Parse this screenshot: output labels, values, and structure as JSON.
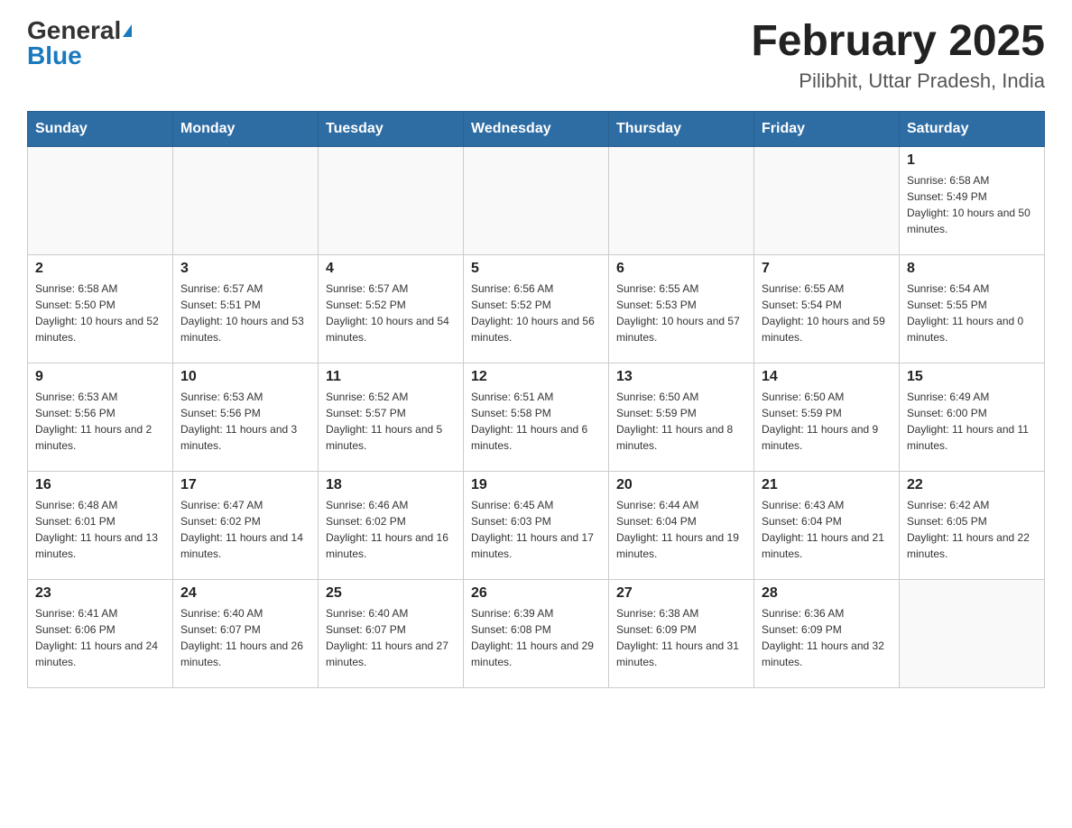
{
  "header": {
    "logo_general": "General",
    "logo_blue": "Blue",
    "title": "February 2025",
    "subtitle": "Pilibhit, Uttar Pradesh, India"
  },
  "weekdays": [
    "Sunday",
    "Monday",
    "Tuesday",
    "Wednesday",
    "Thursday",
    "Friday",
    "Saturday"
  ],
  "weeks": [
    [
      {
        "day": "",
        "info": ""
      },
      {
        "day": "",
        "info": ""
      },
      {
        "day": "",
        "info": ""
      },
      {
        "day": "",
        "info": ""
      },
      {
        "day": "",
        "info": ""
      },
      {
        "day": "",
        "info": ""
      },
      {
        "day": "1",
        "info": "Sunrise: 6:58 AM\nSunset: 5:49 PM\nDaylight: 10 hours and 50 minutes."
      }
    ],
    [
      {
        "day": "2",
        "info": "Sunrise: 6:58 AM\nSunset: 5:50 PM\nDaylight: 10 hours and 52 minutes."
      },
      {
        "day": "3",
        "info": "Sunrise: 6:57 AM\nSunset: 5:51 PM\nDaylight: 10 hours and 53 minutes."
      },
      {
        "day": "4",
        "info": "Sunrise: 6:57 AM\nSunset: 5:52 PM\nDaylight: 10 hours and 54 minutes."
      },
      {
        "day": "5",
        "info": "Sunrise: 6:56 AM\nSunset: 5:52 PM\nDaylight: 10 hours and 56 minutes."
      },
      {
        "day": "6",
        "info": "Sunrise: 6:55 AM\nSunset: 5:53 PM\nDaylight: 10 hours and 57 minutes."
      },
      {
        "day": "7",
        "info": "Sunrise: 6:55 AM\nSunset: 5:54 PM\nDaylight: 10 hours and 59 minutes."
      },
      {
        "day": "8",
        "info": "Sunrise: 6:54 AM\nSunset: 5:55 PM\nDaylight: 11 hours and 0 minutes."
      }
    ],
    [
      {
        "day": "9",
        "info": "Sunrise: 6:53 AM\nSunset: 5:56 PM\nDaylight: 11 hours and 2 minutes."
      },
      {
        "day": "10",
        "info": "Sunrise: 6:53 AM\nSunset: 5:56 PM\nDaylight: 11 hours and 3 minutes."
      },
      {
        "day": "11",
        "info": "Sunrise: 6:52 AM\nSunset: 5:57 PM\nDaylight: 11 hours and 5 minutes."
      },
      {
        "day": "12",
        "info": "Sunrise: 6:51 AM\nSunset: 5:58 PM\nDaylight: 11 hours and 6 minutes."
      },
      {
        "day": "13",
        "info": "Sunrise: 6:50 AM\nSunset: 5:59 PM\nDaylight: 11 hours and 8 minutes."
      },
      {
        "day": "14",
        "info": "Sunrise: 6:50 AM\nSunset: 5:59 PM\nDaylight: 11 hours and 9 minutes."
      },
      {
        "day": "15",
        "info": "Sunrise: 6:49 AM\nSunset: 6:00 PM\nDaylight: 11 hours and 11 minutes."
      }
    ],
    [
      {
        "day": "16",
        "info": "Sunrise: 6:48 AM\nSunset: 6:01 PM\nDaylight: 11 hours and 13 minutes."
      },
      {
        "day": "17",
        "info": "Sunrise: 6:47 AM\nSunset: 6:02 PM\nDaylight: 11 hours and 14 minutes."
      },
      {
        "day": "18",
        "info": "Sunrise: 6:46 AM\nSunset: 6:02 PM\nDaylight: 11 hours and 16 minutes."
      },
      {
        "day": "19",
        "info": "Sunrise: 6:45 AM\nSunset: 6:03 PM\nDaylight: 11 hours and 17 minutes."
      },
      {
        "day": "20",
        "info": "Sunrise: 6:44 AM\nSunset: 6:04 PM\nDaylight: 11 hours and 19 minutes."
      },
      {
        "day": "21",
        "info": "Sunrise: 6:43 AM\nSunset: 6:04 PM\nDaylight: 11 hours and 21 minutes."
      },
      {
        "day": "22",
        "info": "Sunrise: 6:42 AM\nSunset: 6:05 PM\nDaylight: 11 hours and 22 minutes."
      }
    ],
    [
      {
        "day": "23",
        "info": "Sunrise: 6:41 AM\nSunset: 6:06 PM\nDaylight: 11 hours and 24 minutes."
      },
      {
        "day": "24",
        "info": "Sunrise: 6:40 AM\nSunset: 6:07 PM\nDaylight: 11 hours and 26 minutes."
      },
      {
        "day": "25",
        "info": "Sunrise: 6:40 AM\nSunset: 6:07 PM\nDaylight: 11 hours and 27 minutes."
      },
      {
        "day": "26",
        "info": "Sunrise: 6:39 AM\nSunset: 6:08 PM\nDaylight: 11 hours and 29 minutes."
      },
      {
        "day": "27",
        "info": "Sunrise: 6:38 AM\nSunset: 6:09 PM\nDaylight: 11 hours and 31 minutes."
      },
      {
        "day": "28",
        "info": "Sunrise: 6:36 AM\nSunset: 6:09 PM\nDaylight: 11 hours and 32 minutes."
      },
      {
        "day": "",
        "info": ""
      }
    ]
  ]
}
